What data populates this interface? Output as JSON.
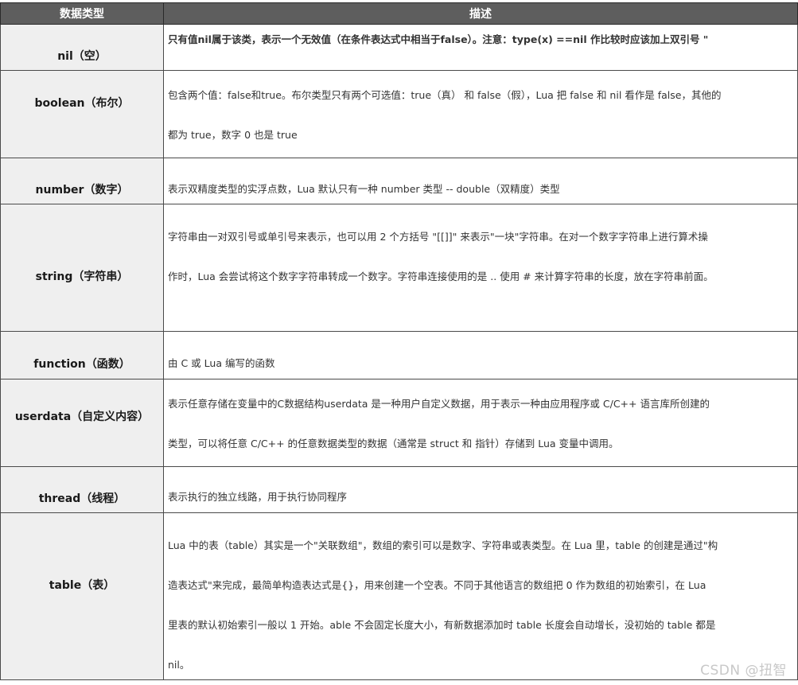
{
  "table": {
    "headers": [
      "数据类型",
      "描述"
    ],
    "rows": [
      {
        "type": "nil（空）",
        "desc": [
          "只有值nil属于该类，表示一个无效值（在条件表达式中相当于false）。注意：type(x) ==nil 作比较时应该加上双引号 \""
        ]
      },
      {
        "type": "boolean（布尔）",
        "desc": [
          "包含两个值：false和true。布尔类型只有两个可选值：true（真） 和 false（假），Lua 把 false 和 nil 看作是 false，其他的",
          "都为 true，数字 0 也是 true"
        ]
      },
      {
        "type": "number（数字）",
        "desc": [
          "表示双精度类型的实浮点数，Lua 默认只有一种 number 类型 -- double（双精度）类型"
        ]
      },
      {
        "type": "string（字符串）",
        "desc": [
          "字符串由一对双引号或单引号来表示，也可以用 2 个方括号 \"[[]]\" 来表示\"一块\"字符串。在对一个数字字符串上进行算术操",
          "作时，Lua 会尝试将这个数字字符串转成一个数字。字符串连接使用的是 .. 使用 # 来计算字符串的长度，放在字符串前面。"
        ]
      },
      {
        "type": "function（函数）",
        "desc": [
          "由 C 或 Lua 编写的函数"
        ]
      },
      {
        "type": "userdata（自定义内容）",
        "desc": [
          "表示任意存储在变量中的C数据结构userdata 是一种用户自定义数据，用于表示一种由应用程序或 C/C++ 语言库所创建的",
          "类型，可以将任意 C/C++ 的任意数据类型的数据（通常是 struct 和 指针）存储到 Lua 变量中调用。"
        ]
      },
      {
        "type": "thread（线程）",
        "desc": [
          "表示执行的独立线路，用于执行协同程序"
        ]
      },
      {
        "type": "table（表）",
        "desc": [
          "Lua 中的表（table）其实是一个\"关联数组\"，数组的索引可以是数字、字符串或表类型。在 Lua 里，table 的创建是通过\"构",
          "造表达式\"来完成，最简单构造表达式是{}，用来创建一个空表。不同于其他语言的数组把 0 作为数组的初始索引，在 Lua",
          "里表的默认初始索引一般以 1 开始。able 不会固定长度大小，有新数据添加时 table 长度会自动增长，没初始的 table 都是",
          "nil。"
        ]
      }
    ]
  },
  "watermark": "CSDN @扭智"
}
